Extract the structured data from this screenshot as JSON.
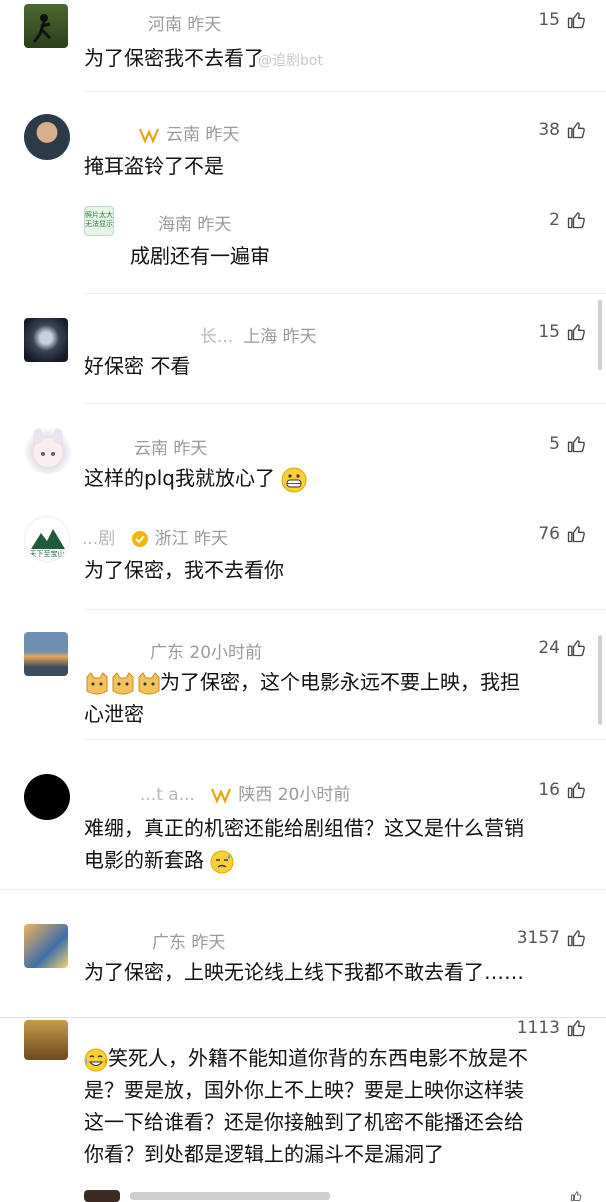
{
  "watermark": "@追剧bot",
  "comments": [
    {
      "user": "",
      "location": "河南",
      "time": "昨天",
      "likes": "15",
      "text": "为了保密我不去看了"
    },
    {
      "user": "",
      "location": "云南",
      "time": "昨天",
      "likes": "38",
      "text": "掩耳盗铃了不是"
    },
    {
      "user": "",
      "location": "海南",
      "time": "昨天",
      "likes": "2",
      "text": "成剧还有一遍审",
      "avatar_text": "照片太大 无法显示"
    },
    {
      "user": "长...",
      "location": "上海",
      "time": "昨天",
      "likes": "15",
      "text": "好保密 不看"
    },
    {
      "user": "",
      "location": "云南",
      "time": "昨天",
      "likes": "5",
      "text": "这样的plq我就放心了"
    },
    {
      "user": "...剧",
      "location": "浙江",
      "time": "昨天",
      "likes": "76",
      "text": "为了保密，我不去看你",
      "avatar_text": "天下至宝山"
    },
    {
      "user": "",
      "location": "广东",
      "time": "20小时前",
      "likes": "24",
      "text_line1": "为了保密，这个电影永远不要上映，我担",
      "text_line2": "心泄密"
    },
    {
      "user": "...t a...",
      "location": "陕西",
      "time": "20小时前",
      "likes": "16",
      "text_line1": "难绷，真正的机密还能给剧组借？这又是什么营销",
      "text_line2": "电影的新套路"
    },
    {
      "user": "",
      "location": "广东",
      "time": "昨天",
      "likes": "3157",
      "text": "为了保密，上映无论线上线下我都不敢去看了……"
    },
    {
      "user": "",
      "location": "",
      "time": "",
      "likes": "1113",
      "text_line1": "笑死人，外籍不能知道你背的东西电影不放是不",
      "text_line2": "是？要是放，国外你上不上映？要是上映你这样装",
      "text_line3": "这一下给谁看？还是你接触到了机密不能播还会给",
      "text_line4": "你看？到处都是逻辑上的漏斗不是漏洞了"
    }
  ],
  "colors": {
    "badge_vip": "#e8a317",
    "verified": "#f4b400",
    "text": "#111111",
    "meta": "#9a9a9a"
  }
}
